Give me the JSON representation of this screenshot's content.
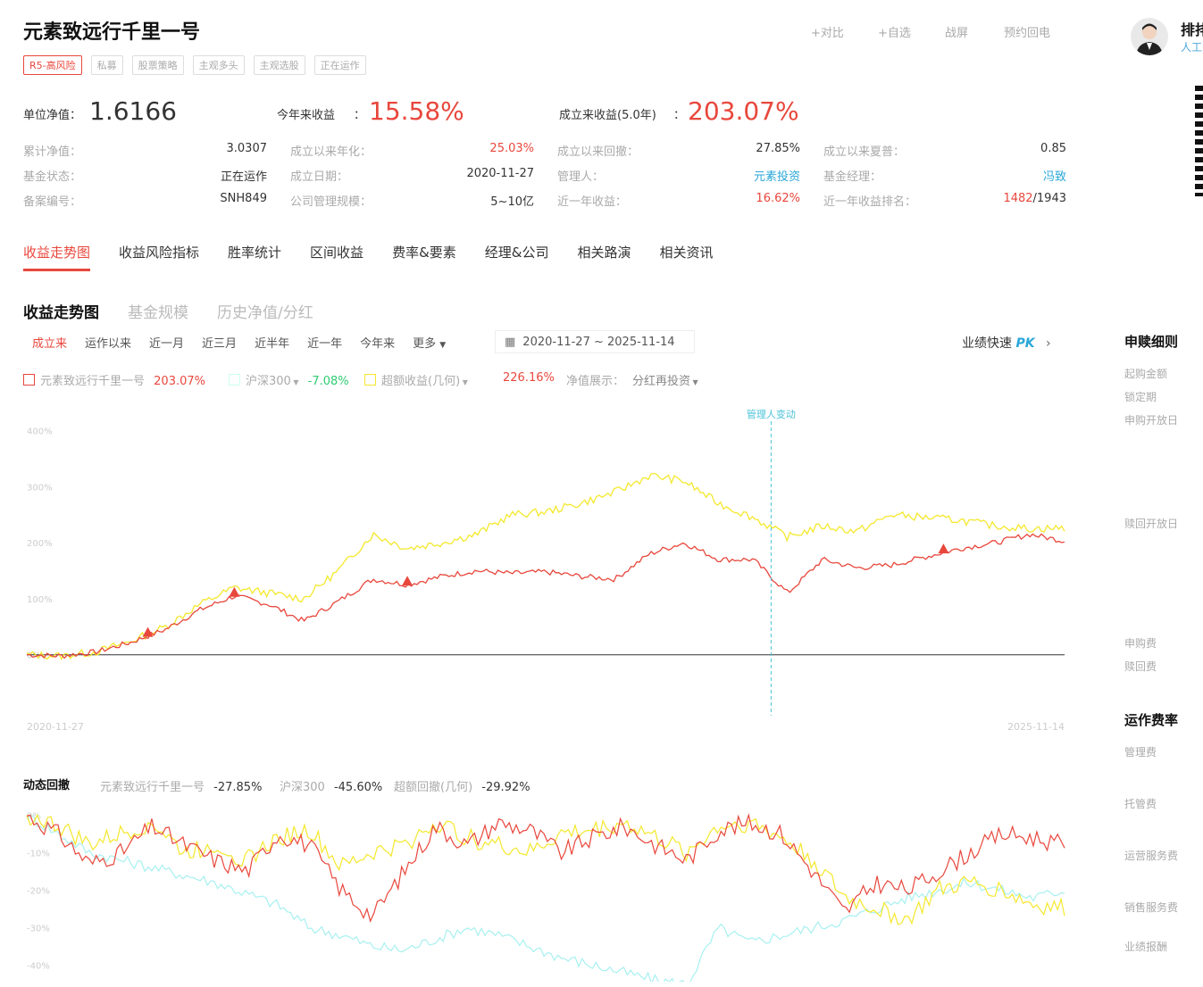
{
  "fund": {
    "name": "元素致远行千里一号",
    "tags": [
      "R5-高风险",
      "私募",
      "股票策略",
      "主观多头",
      "主观选股",
      "正在运作"
    ],
    "actions": [
      "+对比",
      "+自选",
      "战屏",
      "预约回电"
    ]
  },
  "manager": {
    "name": "排排",
    "subtitle": "人工"
  },
  "headline": {
    "nav_label": "单位净值：",
    "nav_value": "1.6166",
    "ytd_label": "今年来收益",
    "ytd_value": "15.58%",
    "since_label": "成立来收益(5.0年)",
    "since_value": "203.07%",
    "colon": "："
  },
  "metrics": {
    "row1": [
      {
        "k": "累计净值：",
        "v": "3.0307"
      },
      {
        "k": "成立以来年化：",
        "v": "25.03%"
      },
      {
        "k": "成立以来回撤：",
        "v": "27.85%"
      },
      {
        "k": "成立以来夏普：",
        "v": "0.85"
      }
    ],
    "row2": [
      {
        "k": "基金状态：",
        "v": "正在运作"
      },
      {
        "k": "成立日期：",
        "v": "2020-11-27"
      },
      {
        "k": "管理人：",
        "v": "元素投资"
      },
      {
        "k": "基金经理：",
        "v": "冯致"
      }
    ],
    "row3": [
      {
        "k": "备案编号：",
        "v": "SNH849"
      },
      {
        "k": "公司管理规模：",
        "v": "5~10亿"
      },
      {
        "k": "近一年收益：",
        "v": "16.62%"
      },
      {
        "k": "近一年收益排名：",
        "v": "1482",
        "v2": "/1943"
      }
    ]
  },
  "tabs": [
    "收益走势图",
    "收益风险指标",
    "胜率统计",
    "区间收益",
    "费率&要素",
    "经理&公司",
    "相关路演",
    "相关资讯"
  ],
  "subtabs": [
    "收益走势图",
    "基金规模",
    "历史净值/分红"
  ],
  "ranges": [
    "成立来",
    "运作以来",
    "近一月",
    "近三月",
    "近半年",
    "近一年",
    "今年来",
    "更多"
  ],
  "date_range": "2020-11-27 ~ 2025-11-14",
  "pk": {
    "text": "业绩快速",
    "pk": "PK",
    "arrow": "›"
  },
  "legend": {
    "fund": {
      "label": "元素致远行千里一号",
      "value": "203.07%"
    },
    "index": {
      "label": "沪深300",
      "value": "-7.08%"
    },
    "excess": {
      "label": "超额收益(几何)",
      "value": "226.16%"
    },
    "nav_show_label": "净值展示：",
    "nav_show_value": "分红再投资"
  },
  "colors": {
    "fund": "#e8473c",
    "index": "#a8f0f0",
    "excess": "#f4e82c",
    "accent": "#e8473c",
    "link": "#2aa7d8"
  },
  "annotation": "管理人变动",
  "chart_data": [
    {
      "type": "line",
      "title": "",
      "x_start": "2020-11-27",
      "x_end": "2025-11-14",
      "ylim": [
        -10,
        420
      ],
      "yticks": [
        "400%",
        "300%",
        "200%",
        "100%",
        "0%"
      ],
      "ytick_values": [
        400,
        300,
        200,
        100,
        0
      ],
      "series": [
        {
          "name": "元素致远行千里一号",
          "x": [
            "2020-11",
            "2021-01",
            "2021-03",
            "2021-05",
            "2021-07",
            "2021-09",
            "2021-11",
            "2022-01",
            "2022-03",
            "2022-05",
            "2022-07",
            "2022-09",
            "2022-11",
            "2023-01",
            "2023-03",
            "2023-05",
            "2023-07",
            "2023-09",
            "2023-11",
            "2024-01",
            "2024-03",
            "2024-05",
            "2024-07",
            "2024-09",
            "2024-11",
            "2025-01",
            "2025-03",
            "2025-05",
            "2025-07",
            "2025-09",
            "2025-11"
          ],
          "y": [
            0,
            -2,
            5,
            22,
            45,
            80,
            105,
            90,
            60,
            95,
            135,
            125,
            140,
            150,
            145,
            148,
            140,
            135,
            180,
            200,
            170,
            170,
            110,
            170,
            155,
            160,
            175,
            190,
            200,
            215,
            203
          ]
        },
        {
          "name": "超额收益(几何)",
          "x": [
            "2020-11",
            "2021-01",
            "2021-03",
            "2021-05",
            "2021-07",
            "2021-09",
            "2021-11",
            "2022-01",
            "2022-03",
            "2022-05",
            "2022-07",
            "2022-09",
            "2022-11",
            "2023-01",
            "2023-03",
            "2023-05",
            "2023-07",
            "2023-09",
            "2023-11",
            "2024-01",
            "2024-03",
            "2024-05",
            "2024-07",
            "2024-09",
            "2024-11",
            "2025-01",
            "2025-03",
            "2025-05",
            "2025-07",
            "2025-09",
            "2025-11"
          ],
          "y": [
            0,
            -2,
            5,
            24,
            50,
            90,
            120,
            110,
            100,
            150,
            215,
            190,
            200,
            215,
            250,
            255,
            270,
            290,
            320,
            310,
            270,
            245,
            210,
            230,
            220,
            250,
            245,
            240,
            230,
            225,
            226
          ]
        }
      ],
      "markers": [
        "2021-06",
        "2021-11",
        "2022-09",
        "2025-04"
      ],
      "x_labels": [
        "2020-11-27",
        "2025-11-14"
      ]
    },
    {
      "type": "line",
      "title": "动态回撤",
      "ylim": [
        -42,
        2
      ],
      "yticks": [
        "0%",
        "-10%",
        "-20%",
        "-30%",
        "-40%"
      ],
      "ytick_values": [
        0,
        -10,
        -20,
        -30,
        -40
      ],
      "series": [
        {
          "name": "元素致远行千里一号",
          "value_label": "-27.85%",
          "y": [
            0,
            -5,
            -13,
            -10,
            -3,
            -8,
            -12,
            -15,
            -5,
            -8,
            -20,
            -27,
            -15,
            -3,
            -8,
            -2,
            -4,
            -10,
            -6,
            -3,
            -8,
            -12,
            -4,
            -2,
            -5,
            -15,
            -26,
            -18,
            -20,
            -15,
            -10,
            -5,
            -6,
            -8
          ]
        },
        {
          "name": "沪深300",
          "value_label": "-45.60%",
          "y": [
            0,
            -5,
            -10,
            -12,
            -14,
            -16,
            -18,
            -21,
            -24,
            -30,
            -32,
            -35,
            -36,
            -33,
            -30,
            -32,
            -35,
            -38,
            -40,
            -42,
            -44,
            -45,
            -30,
            -34,
            -32,
            -30,
            -28,
            -25,
            -22,
            -20,
            -18,
            -20,
            -22,
            -20
          ]
        },
        {
          "name": "超额回撤(几何)",
          "value_label": "-29.92%",
          "y": [
            0,
            -3,
            -8,
            -5,
            -2,
            -10,
            -8,
            -12,
            -6,
            -4,
            -14,
            -10,
            -8,
            -2,
            -6,
            -8,
            -10,
            -5,
            -4,
            -2,
            -6,
            -10,
            -3,
            -2,
            -6,
            -12,
            -22,
            -25,
            -28,
            -20,
            -18,
            -20,
            -24,
            -25
          ]
        }
      ]
    }
  ],
  "side": {
    "section1": "申赎细则",
    "items1": [
      "起购金额",
      "锁定期",
      "申购开放日",
      "赎回开放日",
      "申购费",
      "赎回费"
    ],
    "section2": "运作费率",
    "items2": [
      "管理费",
      "托管费",
      "运营服务费",
      "销售服务费",
      "业绩报酬"
    ]
  },
  "drawdown": {
    "title": "动态回撤"
  }
}
